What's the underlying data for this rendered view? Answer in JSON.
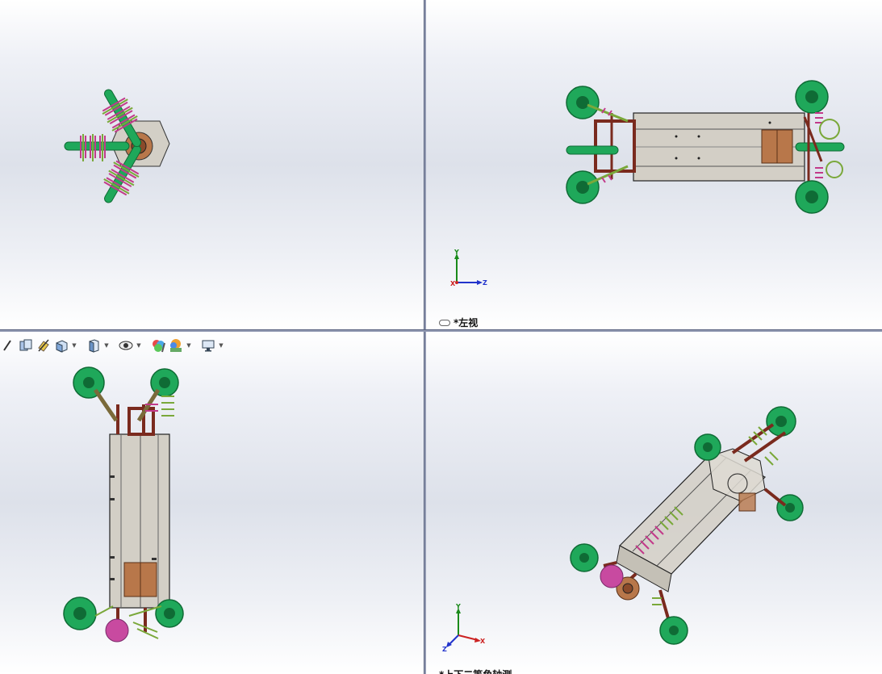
{
  "viewports": {
    "top_left": {
      "label": ""
    },
    "top_right": {
      "label": "*左视",
      "triad": {
        "y": "Y",
        "x": "X",
        "z": "Z"
      }
    },
    "bottom_left": {
      "label": ""
    },
    "bottom_right": {
      "label": "*上下二等角轴测",
      "triad": {
        "y": "Y",
        "x": "X",
        "z": "Z"
      }
    }
  },
  "toolbar": {
    "icons": [
      "zoom-to-area-icon",
      "previous-view-icon",
      "section-view-icon",
      "view-orientation-icon",
      "display-style-icon",
      "hide-show-items-icon",
      "edit-appearance-icon",
      "apply-scene-icon",
      "view-settings-icon"
    ]
  },
  "colors": {
    "wheel": "#1fa85a",
    "wheel_dark": "#0f6b35",
    "spring": "#c23a8a",
    "spring_green": "#7aa83a",
    "frame": "#7a2a1e",
    "body": "#d3cfc6",
    "block": "#b8774a",
    "splitter": "#8f97b0"
  }
}
